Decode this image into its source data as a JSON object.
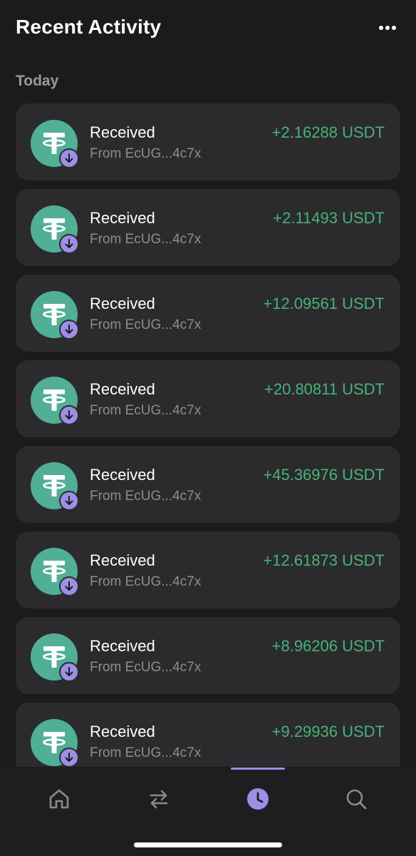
{
  "header": {
    "title": "Recent Activity",
    "more_icon": "more-horizontal-icon"
  },
  "section": {
    "label": "Today"
  },
  "transactions": [
    {
      "label": "Received",
      "from": "From EcUG...4c7x",
      "amount": "+2.16288 USDT"
    },
    {
      "label": "Received",
      "from": "From EcUG...4c7x",
      "amount": "+2.11493 USDT"
    },
    {
      "label": "Received",
      "from": "From EcUG...4c7x",
      "amount": "+12.09561 USDT"
    },
    {
      "label": "Received",
      "from": "From EcUG...4c7x",
      "amount": "+20.80811 USDT"
    },
    {
      "label": "Received",
      "from": "From EcUG...4c7x",
      "amount": "+45.36976 USDT"
    },
    {
      "label": "Received",
      "from": "From EcUG...4c7x",
      "amount": "+12.61873 USDT"
    },
    {
      "label": "Received",
      "from": "From EcUG...4c7x",
      "amount": "+8.96206 USDT"
    },
    {
      "label": "Received",
      "from": "From EcUG...4c7x",
      "amount": "+9.29936 USDT"
    }
  ],
  "tabbar": {
    "tabs": [
      {
        "icon": "home-icon",
        "active": false
      },
      {
        "icon": "swap-icon",
        "active": false
      },
      {
        "icon": "clock-icon",
        "active": true
      },
      {
        "icon": "search-icon",
        "active": false
      }
    ]
  },
  "colors": {
    "background": "#1b1b1c",
    "card": "#2b2b2d",
    "token_green": "#50af95",
    "amount_green": "#49b27a",
    "accent_purple": "#9d8ee6",
    "muted_text": "#8d8d90"
  }
}
